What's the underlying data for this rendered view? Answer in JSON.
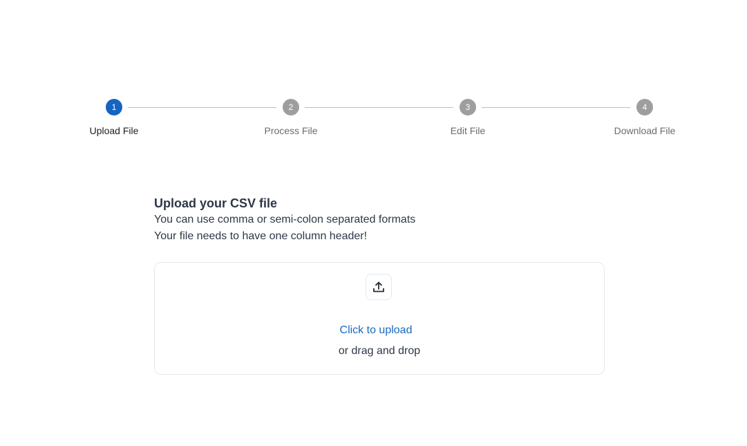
{
  "stepper": {
    "steps": [
      {
        "number": "1",
        "label": "Upload File",
        "active": true
      },
      {
        "number": "2",
        "label": "Process File",
        "active": false
      },
      {
        "number": "3",
        "label": "Edit File",
        "active": false
      },
      {
        "number": "4",
        "label": "Download File",
        "active": false
      }
    ]
  },
  "upload": {
    "title": "Upload your CSV file",
    "desc_line1": "You can use comma or semi-colon separated formats",
    "desc_line2": "Your file needs to have one column header!",
    "click_label": "Click to upload",
    "drag_label": "or drag and drop",
    "icon": "upload-icon"
  },
  "colors": {
    "accent": "#1565c0",
    "inactive_step": "#9e9e9e",
    "link": "#1769c2"
  }
}
